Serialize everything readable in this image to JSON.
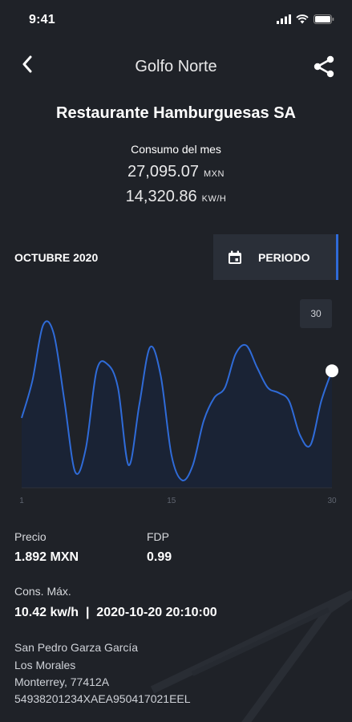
{
  "status_bar": {
    "time": "9:41"
  },
  "header": {
    "title": "Golfo Norte",
    "back_icon": "chevron-left-icon",
    "share_icon": "share-icon"
  },
  "client": {
    "name": "Restaurante Hamburguesas SA"
  },
  "consumo": {
    "label": "Consumo del mes",
    "amount": "27,095.07",
    "amount_unit": "MXN",
    "energy": "14,320.86",
    "energy_unit": "KW/H"
  },
  "period": {
    "month": "OCTUBRE 2020",
    "button_label": "PERIODO",
    "button_icon": "calendar-icon"
  },
  "chart_data": {
    "type": "area",
    "x": [
      1,
      2,
      3,
      4,
      5,
      6,
      7,
      8,
      9,
      10,
      11,
      12,
      13,
      14,
      15,
      16,
      17,
      18,
      19,
      20,
      21,
      22,
      23,
      24,
      25,
      26,
      27,
      28,
      29,
      30
    ],
    "values": [
      40,
      62,
      95,
      90,
      50,
      8,
      22,
      68,
      72,
      58,
      12,
      48,
      82,
      65,
      18,
      3,
      12,
      38,
      52,
      58,
      78,
      83,
      70,
      58,
      55,
      50,
      30,
      24,
      50,
      68
    ],
    "x_ticks": [
      "1",
      "15",
      "30"
    ],
    "ylim": [
      0,
      100
    ],
    "selected_point_label": "30",
    "line_color": "#2f6bd8",
    "fill_color": "#1a2335",
    "grid": false
  },
  "info": {
    "precio_label": "Precio",
    "precio_value": "1.892 MXN",
    "fdp_label": "FDP",
    "fdp_value": "0.99",
    "cons_max_label": "Cons. Máx.",
    "cons_max_value": "10.42 kw/h  |  2020-10-20 20:10:00"
  },
  "address": {
    "line1": "San Pedro Garza García",
    "line2": "Los Morales",
    "line3": "Monterrey, 77412A",
    "line4": "54938201234XAEA950417021EEL"
  },
  "colors": {
    "background": "#1f2228",
    "accent": "#2f6bd8",
    "panel": "#2a2f38"
  }
}
